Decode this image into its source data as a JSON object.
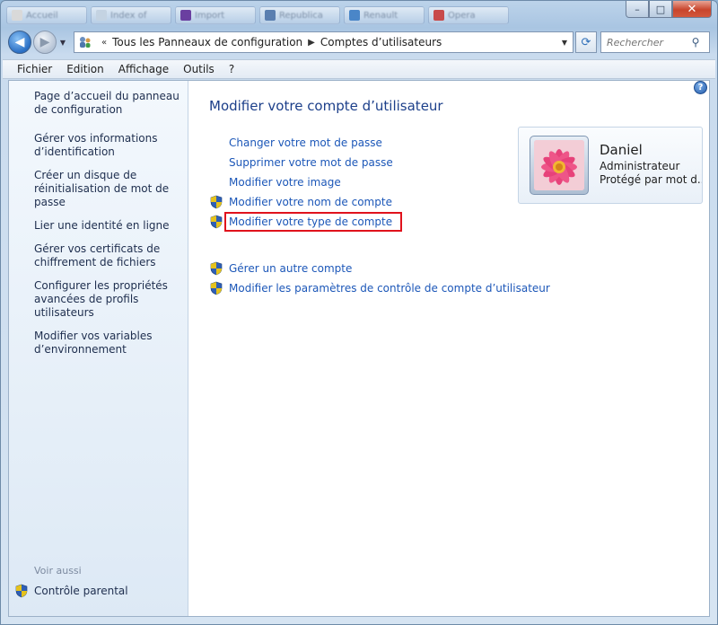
{
  "background_tabs": [
    {
      "label": "Accueil",
      "color": "#d9d9d9"
    },
    {
      "label": "Index of",
      "color": "#c4d3e2"
    },
    {
      "label": "Import",
      "color": "#6a3fa0"
    },
    {
      "label": "Republica",
      "color": "#5a7fb0"
    },
    {
      "label": "Renault",
      "color": "#4a86c8"
    },
    {
      "label": "Opera",
      "color": "#c84a4a"
    },
    {
      "label": "Opera",
      "color": "#c84a4a"
    }
  ],
  "window": {
    "minimize_glyph": "–",
    "maximize_glyph": "□",
    "close_glyph": "✕"
  },
  "address": {
    "prefix": "«",
    "crumbs": [
      "Tous les Panneaux de configuration",
      "Comptes d’utilisateurs"
    ],
    "search_placeholder": "Rechercher"
  },
  "menu": [
    "Fichier",
    "Edition",
    "Affichage",
    "Outils",
    "?"
  ],
  "sidebar": {
    "links": [
      "Page d’accueil du panneau de configuration",
      "Gérer vos informations d’identification",
      "Créer un disque de réinitialisation de mot de passe",
      "Lier une identité en ligne",
      "Gérer vos certificats de chiffrement de fichiers",
      "Configurer les propriétés avancées de profils utilisateurs",
      "Modifier vos variables d’environnement"
    ],
    "see_also": "Voir aussi",
    "parental": "Contrôle parental"
  },
  "main": {
    "title": "Modifier votre compte d’utilisateur",
    "tasks": [
      {
        "label": "Changer votre mot de passe",
        "shield": false
      },
      {
        "label": "Supprimer votre mot de passe",
        "shield": false
      },
      {
        "label": "Modifier votre image",
        "shield": false
      },
      {
        "label": "Modifier votre nom de compte",
        "shield": true
      },
      {
        "label": "Modifier votre type de compte",
        "shield": true,
        "highlighted": true
      },
      {
        "label": "Gérer un autre compte",
        "shield": true
      },
      {
        "label": "Modifier les paramètres de contrôle de compte d’utilisateur",
        "shield": true
      }
    ]
  },
  "user": {
    "name": "Daniel",
    "role": "Administrateur",
    "status": "Protégé par mot d..."
  },
  "colors": {
    "link": "#1c57b8",
    "title": "#1c3f8a",
    "highlight_border": "#e0121c"
  }
}
